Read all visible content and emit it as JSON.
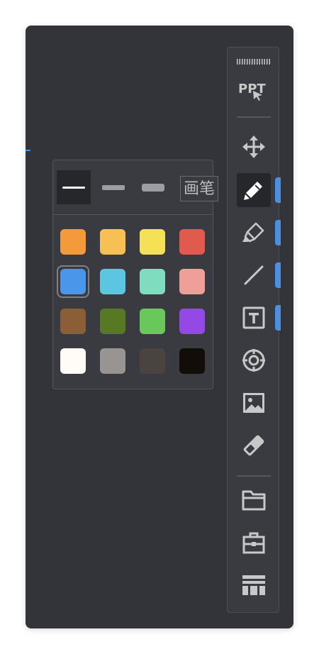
{
  "ppt": {
    "label": "PPT"
  },
  "tooltip": {
    "text": "画笔"
  },
  "tools": [
    {
      "name": "move-icon",
      "active": false
    },
    {
      "name": "pen-icon",
      "active": true
    },
    {
      "name": "highlighter-icon",
      "active": false
    },
    {
      "name": "line-icon",
      "active": false
    },
    {
      "name": "text-icon",
      "active": false
    },
    {
      "name": "target-icon",
      "active": false
    },
    {
      "name": "image-icon",
      "active": false
    },
    {
      "name": "eraser-icon",
      "active": false
    },
    {
      "name": "folder-icon",
      "active": false
    },
    {
      "name": "toolbox-icon",
      "active": false
    },
    {
      "name": "table-icon",
      "active": false
    }
  ],
  "stroke_widths": [
    "thin",
    "medium",
    "thick"
  ],
  "selected_stroke": "thin",
  "colors": [
    [
      "#f39a3a",
      "#f6c055",
      "#f5e155",
      "#e05a4e"
    ],
    [
      "#4a96ea",
      "#5cc5e2",
      "#7fdcbe",
      "#f09f98"
    ],
    [
      "#8c5e35",
      "#587823",
      "#68c85a",
      "#9448e6"
    ],
    [
      "#fffcf7",
      "#979492",
      "#4a4440",
      "#120d09"
    ]
  ],
  "selected_color": "#4a96ea"
}
